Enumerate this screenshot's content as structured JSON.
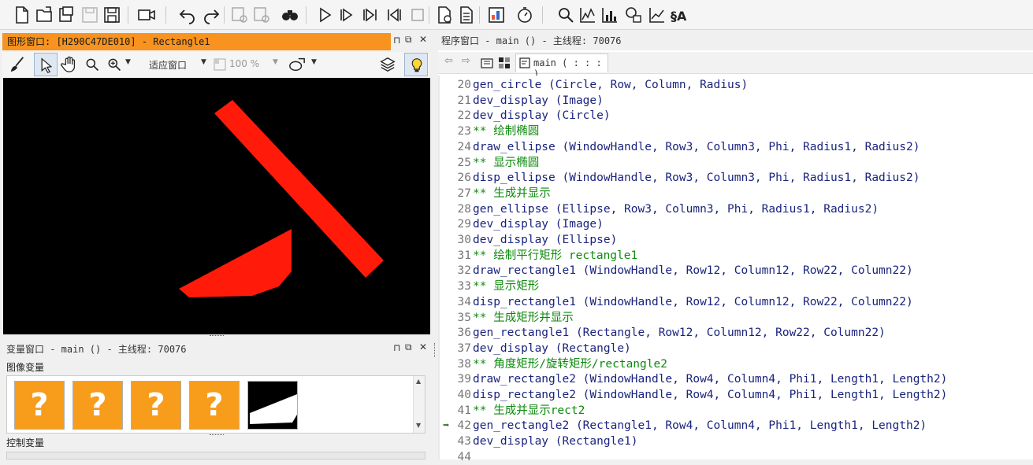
{
  "graphics_window": {
    "title": "图形窗口: [H290C47DE010] - Rectangle1",
    "fit_window_label": "适应窗口",
    "zoom_label": "100 %"
  },
  "variable_window": {
    "title": "变量窗口 - main () - 主线程: 70076",
    "image_vars_label": "图像变量",
    "control_vars_label": "控制变量",
    "thumbnails": [
      "?",
      "?",
      "?",
      "?"
    ]
  },
  "program_window": {
    "title": "程序窗口 - main () - 主线程: 70076",
    "procedure_tab": "main ( : : : )",
    "current_line": 42,
    "lines": [
      {
        "n": "20",
        "type": "op",
        "text": "gen_circle (Circle, Row, Column, Radius)"
      },
      {
        "n": "21",
        "type": "op",
        "text": "dev_display (Image)"
      },
      {
        "n": "22",
        "type": "op",
        "text": "dev_display (Circle)"
      },
      {
        "n": "23",
        "type": "cmt",
        "text": "** 绘制椭圆"
      },
      {
        "n": "24",
        "type": "op",
        "text": "draw_ellipse (WindowHandle, Row3, Column3, Phi, Radius1, Radius2)"
      },
      {
        "n": "25",
        "type": "cmt",
        "text": "** 显示椭圆"
      },
      {
        "n": "26",
        "type": "op",
        "text": "disp_ellipse (WindowHandle, Row3, Column3, Phi, Radius1, Radius2)"
      },
      {
        "n": "27",
        "type": "cmt",
        "text": "** 生成并显示"
      },
      {
        "n": "28",
        "type": "op",
        "text": "gen_ellipse (Ellipse, Row3, Column3, Phi, Radius1, Radius2)"
      },
      {
        "n": "29",
        "type": "op",
        "text": "dev_display (Image)"
      },
      {
        "n": "30",
        "type": "op",
        "text": "dev_display (Ellipse)"
      },
      {
        "n": "31",
        "type": "cmt",
        "text": "** 绘制平行矩形 rectangle1"
      },
      {
        "n": "32",
        "type": "op",
        "text": "draw_rectangle1 (WindowHandle, Row12, Column12, Row22, Column22)"
      },
      {
        "n": "33",
        "type": "cmt",
        "text": "** 显示矩形"
      },
      {
        "n": "34",
        "type": "op",
        "text": "disp_rectangle1 (WindowHandle, Row12, Column12, Row22, Column22)"
      },
      {
        "n": "35",
        "type": "cmt",
        "text": "** 生成矩形并显示"
      },
      {
        "n": "36",
        "type": "op",
        "text": "gen_rectangle1 (Rectangle, Row12, Column12, Row22, Column22)"
      },
      {
        "n": "37",
        "type": "op",
        "text": "dev_display (Rectangle)"
      },
      {
        "n": "38",
        "type": "cmt",
        "text": "** 角度矩形/旋转矩形/rectangle2"
      },
      {
        "n": "39",
        "type": "op",
        "text": "draw_rectangle2 (WindowHandle, Row4, Column4, Phi1, Length1, Length2)"
      },
      {
        "n": "40",
        "type": "op",
        "text": "disp_rectangle2 (WindowHandle, Row4, Column4, Phi1, Length1, Length2)"
      },
      {
        "n": "41",
        "type": "cmt",
        "text": "** 生成并显示rect2"
      },
      {
        "n": "42",
        "type": "op",
        "text": "gen_rectangle2 (Rectangle1, Row4, Column4, Phi1, Length1, Length2)"
      },
      {
        "n": "43",
        "type": "op",
        "text": "dev_display (Rectangle1)"
      },
      {
        "n": "44",
        "type": "op",
        "text": ""
      }
    ]
  },
  "colors": {
    "accent": "#f7931e",
    "region": "#ff1a0a",
    "code_op": "#1a237e",
    "code_comment": "#0d8a0d"
  },
  "toolbar_icons": [
    "new-file-icon",
    "open-file-icon",
    "open-program-icon",
    "save-disabled-icon",
    "save-icon",
    "record-icon",
    "undo-icon",
    "redo-icon",
    "check-icon",
    "check-all-icon",
    "find-binoculars-icon",
    "run-icon",
    "step-icon",
    "step-over-icon",
    "step-back-icon",
    "stop-icon",
    "insert-icon",
    "list-icon",
    "graphics-icon",
    "timer-icon",
    "search-icon",
    "histogram-icon",
    "bar-chart-icon",
    "features-icon",
    "line-chart-icon",
    "text-icon"
  ]
}
